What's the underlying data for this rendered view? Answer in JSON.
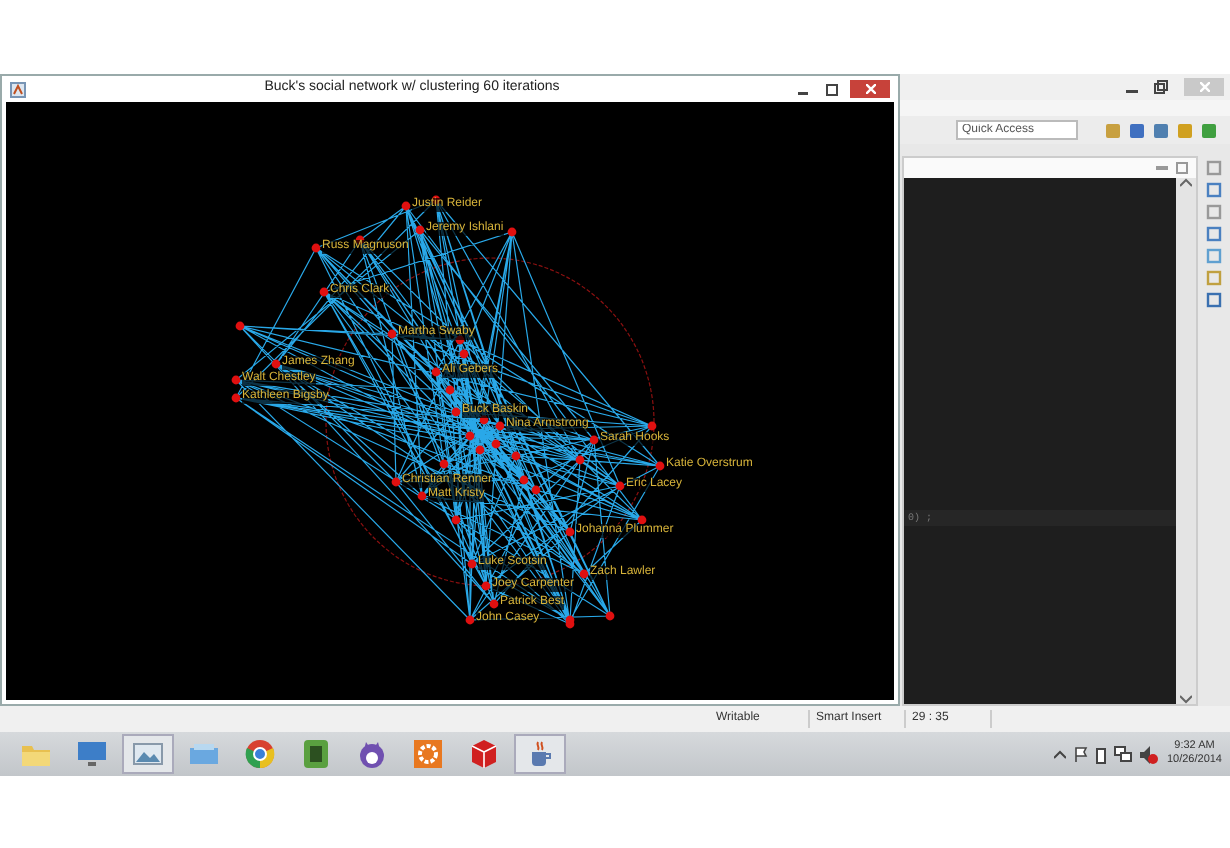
{
  "graph_window": {
    "title": "Buck's social network w/ clustering 60 iterations",
    "nodes": [
      {
        "label": "Justin Reider"
      },
      {
        "label": "Jeremy Ishlani"
      },
      {
        "label": "Russ Magnuson"
      },
      {
        "label": "Chris Clark"
      },
      {
        "label": "Martha Swaby"
      },
      {
        "label": "James Zhang"
      },
      {
        "label": "Walt Chestley"
      },
      {
        "label": "Kathleen Bigsby"
      },
      {
        "label": "Ali Gebers"
      },
      {
        "label": "Buck Baskin"
      },
      {
        "label": "Nina Armstrong"
      },
      {
        "label": "Sarah Hooks"
      },
      {
        "label": "Katie Overstrum"
      },
      {
        "label": "Eric Lacey"
      },
      {
        "label": "Christian Renner"
      },
      {
        "label": "Matt Kristy"
      },
      {
        "label": "Johanna Plummer"
      },
      {
        "label": "Luke Scotsin"
      },
      {
        "label": "Joey Carpenter"
      },
      {
        "label": "Patrick Best"
      },
      {
        "label": "Zach Lawler"
      },
      {
        "label": "John Casey"
      }
    ]
  },
  "ide": {
    "quick_access": {
      "placeholder": "Quick Access"
    },
    "editor_lines": [
      "0) ;"
    ],
    "status_bar": [
      "Writable",
      "Smart Insert",
      "29 : 35"
    ]
  },
  "taskbar": {
    "apps": [
      {
        "kind": "folder",
        "selected": false
      },
      {
        "kind": "monitor",
        "selected": false
      },
      {
        "kind": "picture",
        "selected": true
      },
      {
        "kind": "drive",
        "selected": false
      },
      {
        "kind": "browser",
        "selected": false
      },
      {
        "kind": "notebook",
        "selected": false
      },
      {
        "kind": "cat",
        "selected": false
      },
      {
        "kind": "gear",
        "selected": false
      },
      {
        "kind": "cube",
        "selected": false
      },
      {
        "kind": "cup",
        "selected": true
      }
    ],
    "clock": {
      "time": "9:32 AM",
      "date": "10/26/2014"
    }
  }
}
